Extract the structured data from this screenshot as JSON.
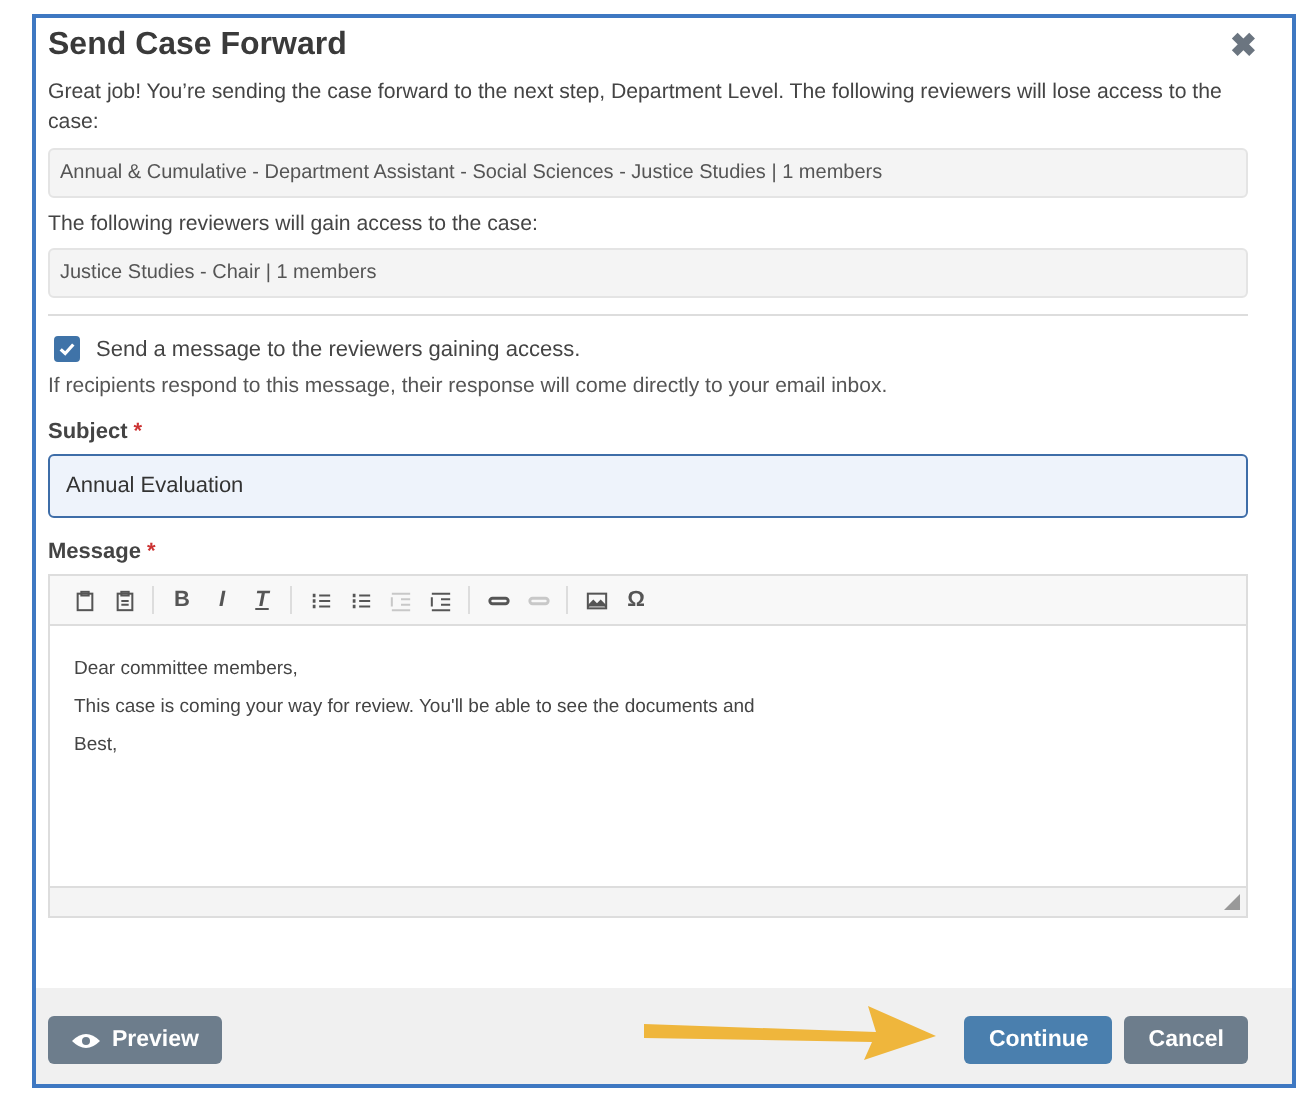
{
  "dialog": {
    "title": "Send Case Forward",
    "close_label": "✖"
  },
  "intro": "Great job! You’re sending the case forward to the next step, Department Level. The following reviewers will lose access to the case:",
  "losing_reviewers": "Annual & Cumulative - Department Assistant - Social Sciences - Justice Studies | 1 members",
  "gaining_label": "The following reviewers will gain access to the case:",
  "gaining_reviewers": "Justice Studies - Chair | 1 members",
  "send_message": {
    "label": "Send a message to the reviewers gaining access.",
    "checked": true,
    "note": "If recipients respond to this message, their response will come directly to your email inbox."
  },
  "subject": {
    "label": "Subject",
    "required_mark": "*",
    "value": "Annual Evaluation"
  },
  "message": {
    "label": "Message",
    "required_mark": "*",
    "toolbar": [
      {
        "kind": "paste",
        "disabled": false
      },
      {
        "kind": "paste-text",
        "disabled": false
      },
      {
        "kind": "bold",
        "label": "B",
        "disabled": false
      },
      {
        "kind": "italic",
        "label": "I",
        "disabled": false
      },
      {
        "kind": "clear-format",
        "label": "T",
        "disabled": false
      },
      {
        "kind": "numbered-list",
        "disabled": false
      },
      {
        "kind": "bullet-list",
        "disabled": false
      },
      {
        "kind": "outdent",
        "disabled": true
      },
      {
        "kind": "indent",
        "disabled": false
      },
      {
        "kind": "link",
        "disabled": false
      },
      {
        "kind": "unlink",
        "disabled": true
      },
      {
        "kind": "image",
        "disabled": false
      },
      {
        "kind": "symbol",
        "label": "Ω",
        "disabled": false
      }
    ],
    "paragraphs": [
      "Dear committee members,",
      "This case is coming your way for review. You'll be able to see the documents and",
      "Best,"
    ]
  },
  "footer": {
    "preview": "Preview",
    "continue": "Continue",
    "cancel": "Cancel"
  }
}
